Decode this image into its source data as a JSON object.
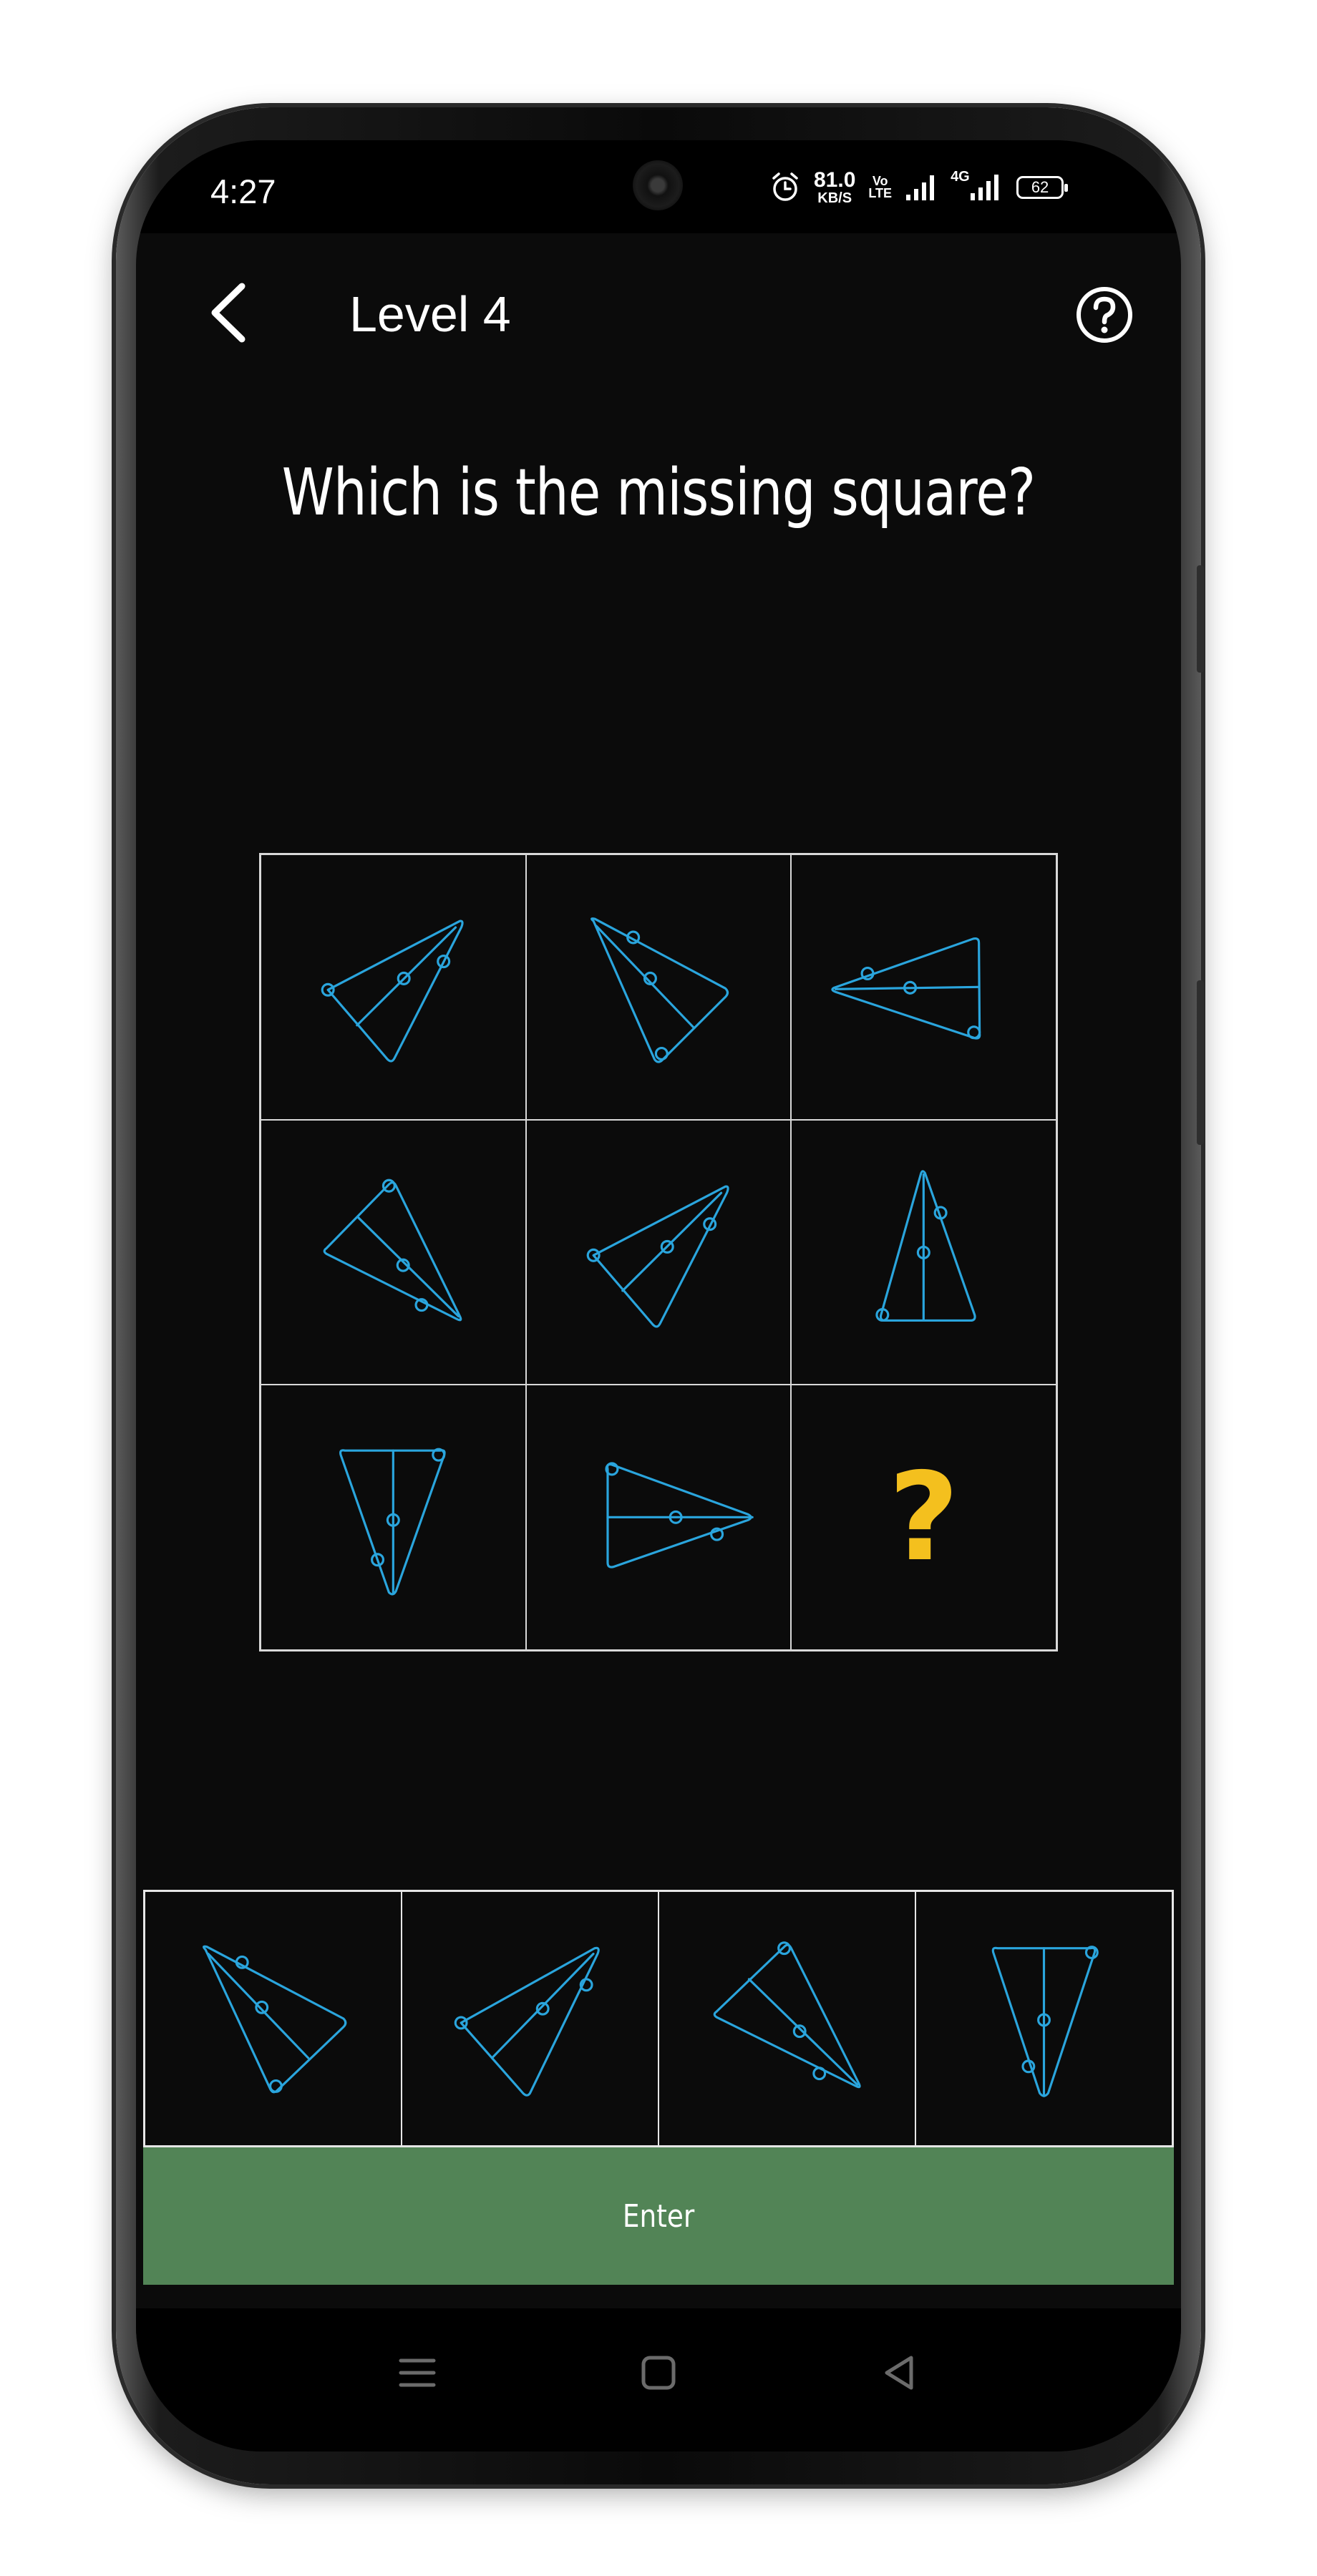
{
  "status_bar": {
    "time": "4:27",
    "net_speed_value": "81.0",
    "net_speed_unit": "KB/S",
    "volte_top": "Vo",
    "volte_bottom": "LTE",
    "network_label": "4G",
    "battery_level": "62",
    "icons": [
      "alarm-icon",
      "signal-icon",
      "signal-4g-icon",
      "battery-icon"
    ]
  },
  "header": {
    "back_icon": "chevron-left-icon",
    "title": "Level 4",
    "help_icon": "question-circle-icon"
  },
  "question": "Which is the missing square?",
  "puzzle": {
    "missing_symbol": "?",
    "shape_color": "#2aa5dd",
    "missing_color": "#f4c01e",
    "cells": [
      "triangle-figure",
      "triangle-figure",
      "triangle-figure",
      "triangle-figure",
      "triangle-figure",
      "triangle-figure",
      "triangle-figure",
      "triangle-figure",
      "missing-cell"
    ]
  },
  "options": [
    "option-1",
    "option-2",
    "option-3",
    "option-4"
  ],
  "enter_label": "Enter",
  "colors": {
    "background": "#0b0b0b",
    "enter_button": "#528456",
    "grid_lines": "#d9d9d9"
  },
  "nav": [
    "menu-icon",
    "home-icon",
    "back-triangle-icon"
  ]
}
